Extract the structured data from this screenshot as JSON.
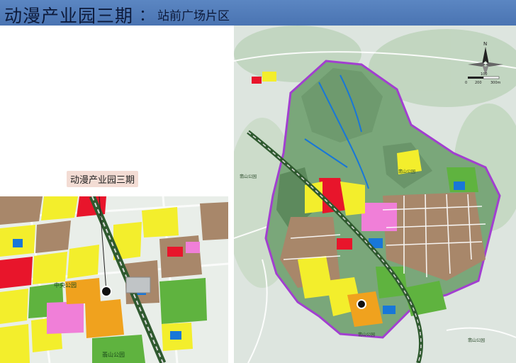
{
  "title": {
    "main": "动漫产业园三期",
    "separator": "：",
    "sub": "站前广场片区"
  },
  "callout": {
    "label": "动漫产业园三期"
  },
  "left_map": {
    "park_labels": [
      "中央公园",
      "翡山公园"
    ]
  },
  "right_map": {
    "compass": {
      "north_label": "N",
      "scale_labels": [
        "0",
        "100",
        "200",
        "300m"
      ]
    },
    "place_labels": [
      "翡山公园",
      "翡山公园",
      "翡山公园",
      "翡山公园"
    ]
  },
  "colors": {
    "title_bar": "#4a74b2",
    "residential_yellow": "#f3ee2c",
    "commercial_red": "#e8152b",
    "industrial_brown": "#a8876a",
    "green_space": "#5fb33f",
    "forest": "#76a878",
    "education_pink": "#f07fd8",
    "water": "#1877d8",
    "orange": "#f0a21e",
    "boundary_purple": "#a23fd0"
  }
}
